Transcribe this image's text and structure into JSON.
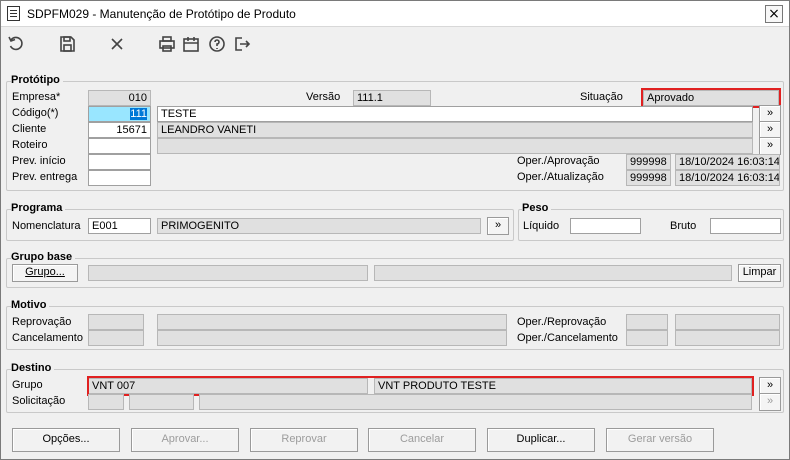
{
  "window": {
    "title": "SDPFM029 - Manutenção de Protótipo de Produto",
    "close": "×"
  },
  "toolbar": {
    "icons": [
      "undo-icon",
      "save-icon",
      "cancel-icon",
      "print-icon",
      "calendar-icon",
      "help-icon",
      "exit-icon"
    ]
  },
  "prototipo": {
    "legend": "Protótipo",
    "empresa_label": "Empresa*",
    "empresa": "010",
    "versao_label": "Versão",
    "versao": "111.1",
    "situacao_label": "Situação",
    "situacao": "Aprovado",
    "codigo_label": "Código(*)",
    "codigo": "111",
    "codigo_desc": "TESTE",
    "cliente_label": "Cliente",
    "cliente": "15671",
    "cliente_desc": "LEANDRO VANETI",
    "roteiro_label": "Roteiro",
    "roteiro": "",
    "roteiro_desc": "",
    "prev_inicio_label": "Prev. início",
    "prev_inicio": "",
    "prev_entrega_label": "Prev. entrega",
    "prev_entrega": "",
    "oper_aprovacao_label": "Oper./Aprovação",
    "oper_aprovacao_user": "999998",
    "oper_aprovacao_date": "18/10/2024 16:03:14",
    "oper_atualizacao_label": "Oper./Atualização",
    "oper_atualizacao_user": "999998",
    "oper_atualizacao_date": "18/10/2024 16:03:14",
    "lookup": "»"
  },
  "programa": {
    "legend": "Programa",
    "nomenclatura_label": "Nomenclatura",
    "nomenclatura": "E001",
    "nomenclatura_desc": "PRIMOGENITO",
    "lookup": "»"
  },
  "peso": {
    "legend": "Peso",
    "liquido_label": "Líquido",
    "liquido": "",
    "bruto_label": "Bruto",
    "bruto": ""
  },
  "grupo_base": {
    "legend": "Grupo base",
    "grupo_btn": "Grupo...",
    "field1": "",
    "field2": "",
    "limpar_btn": "Limpar"
  },
  "motivo": {
    "legend": "Motivo",
    "reprovacao_label": "Reprovação",
    "cancelamento_label": "Cancelamento",
    "oper_reprovacao_label": "Oper./Reprovação",
    "oper_cancelamento_label": "Oper./Cancelamento"
  },
  "destino": {
    "legend": "Destino",
    "grupo_label": "Grupo",
    "grupo_code": "VNT 007",
    "grupo_desc": "VNT PRODUTO TESTE",
    "solicitacao_label": "Solicitação",
    "lookup": "»"
  },
  "footer": {
    "opcoes": "Opções...",
    "aprovar": "Aprovar...",
    "reprovar": "Reprovar",
    "cancelar": "Cancelar",
    "duplicar": "Duplicar...",
    "gerar_versao": "Gerar versão"
  },
  "colors": {
    "highlight": "#e02020",
    "selected_field": "#99e6ff",
    "selected_text_bg": "#0078d7"
  }
}
